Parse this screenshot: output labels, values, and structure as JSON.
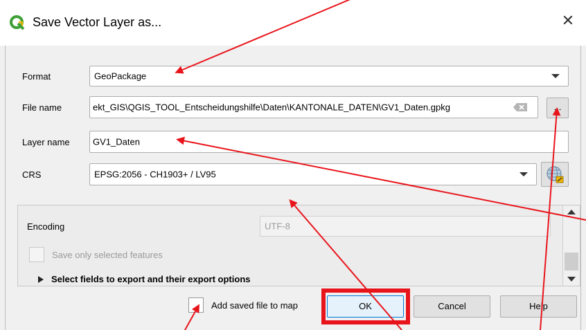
{
  "window": {
    "title": "Save Vector Layer as...",
    "app_icon": "qgis-logo-icon",
    "close_glyph": "✕"
  },
  "form": {
    "format_label": "Format",
    "format_value": "GeoPackage",
    "filename_label": "File name",
    "filename_value": "ekt_GIS\\QGIS_TOOL_Entscheidungshilfe\\Daten\\KANTONALE_DATEN\\GV1_Daten.gpkg",
    "browse_label": "...",
    "layername_label": "Layer name",
    "layername_value": "GV1_Daten",
    "crs_label": "CRS",
    "crs_value": "EPSG:2056 - CH1903+ / LV95"
  },
  "options": {
    "encoding_label": "Encoding",
    "encoding_value": "UTF-8",
    "save_selected_label": "Save only selected features",
    "select_fields_label": "Select fields to export and their export options"
  },
  "footer": {
    "add_to_map_label": "Add saved file to map",
    "ok_label": "OK",
    "cancel_label": "Cancel",
    "help_label": "Help"
  },
  "colors": {
    "annotation_red": "#e8141b",
    "qgis_green": "#3d9e36",
    "qgis_yellow": "#f0b400"
  }
}
